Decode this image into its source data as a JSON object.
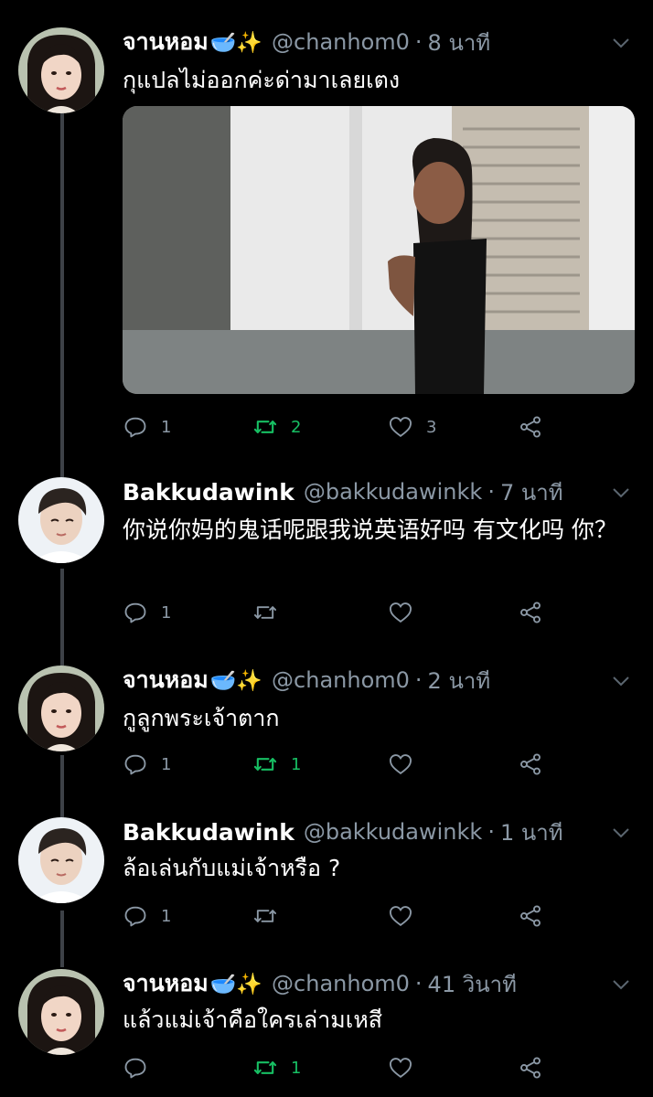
{
  "tweets": [
    {
      "name": "จานหอม",
      "emoji": "🥣✨",
      "handle": "@chanhom0",
      "time": "8 นาที",
      "text": "กุแปลไม่ออกค่ะด่ามาเลยเตง",
      "replies": "1",
      "retweets": "2",
      "likes": "3",
      "retweeted": true
    },
    {
      "name": "Bakkudawink",
      "emoji": "",
      "handle": "@bakkudawinkk",
      "time": "7 นาที",
      "text": "你说你妈的鬼话呢跟我说英语好吗 有文化吗 你？",
      "replies": "1",
      "retweets": "",
      "likes": "",
      "retweeted": false
    },
    {
      "name": "จานหอม",
      "emoji": "🥣✨",
      "handle": "@chanhom0",
      "time": "2 นาที",
      "text": "กูลูกพระเจ้าตาก",
      "replies": "1",
      "retweets": "1",
      "likes": "",
      "retweeted": true
    },
    {
      "name": "Bakkudawink",
      "emoji": "",
      "handle": "@bakkudawinkk",
      "time": "1 นาที",
      "text": "ล้อเล่นกับแม่เจ้าหรือ ?",
      "replies": "1",
      "retweets": "",
      "likes": "",
      "retweeted": false
    },
    {
      "name": "จานหอม",
      "emoji": "🥣✨",
      "handle": "@chanhom0",
      "time": "41 วินาที",
      "text": "แล้วแม่เจ้าคือใครเล่ามเหสี",
      "replies": "",
      "retweets": "1",
      "likes": "",
      "retweeted": true
    }
  ],
  "colors": {
    "background": "#000000",
    "secondary_text": "#8b98a5",
    "retweet_active": "#17bf63",
    "thread_line": "#3d4147"
  },
  "icons": [
    "reply-icon",
    "retweet-icon",
    "like-icon",
    "share-icon",
    "chevron-down-icon"
  ]
}
